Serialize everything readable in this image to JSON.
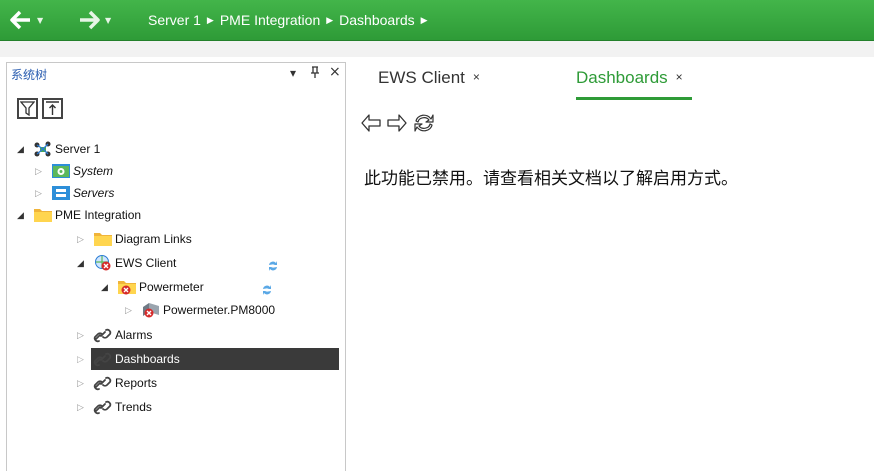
{
  "breadcrumb": {
    "items": [
      "Server 1",
      "PME Integration",
      "Dashboards"
    ]
  },
  "panel": {
    "title": "系统树",
    "ctl_pin_dropdown": "▾",
    "ctl_pin": "ᵻ",
    "ctl_close": "×"
  },
  "tree": [
    {
      "label": "Server 1",
      "icon": "server-network-icon",
      "italic": false
    },
    {
      "label": "System",
      "icon": "system-gear-folder-icon",
      "italic": true
    },
    {
      "label": "Servers",
      "icon": "servers-folder-icon",
      "italic": true
    },
    {
      "label": "PME Integration",
      "icon": "folder-icon",
      "italic": false
    },
    {
      "label": "Diagram Links",
      "icon": "folder-icon",
      "italic": false
    },
    {
      "label": "EWS Client",
      "icon": "ews-client-error-icon",
      "italic": false
    },
    {
      "label": "Powermeter",
      "icon": "folder-error-icon",
      "italic": false
    },
    {
      "label": "Powermeter.PM8000",
      "icon": "device-error-icon",
      "italic": false
    },
    {
      "label": "Alarms",
      "icon": "link-icon",
      "italic": false
    },
    {
      "label": "Dashboards",
      "icon": "link-icon",
      "italic": false
    },
    {
      "label": "Reports",
      "icon": "link-icon",
      "italic": false
    },
    {
      "label": "Trends",
      "icon": "link-icon",
      "italic": false
    }
  ],
  "tabs": [
    {
      "label": "EWS Client",
      "close": "×",
      "active": false
    },
    {
      "label": "Dashboards",
      "close": "×",
      "active": true
    }
  ],
  "content": {
    "message": "此功能已禁用。请查看相关文档以了解启用方式。"
  },
  "colors": {
    "accent_green": "#2e9b37",
    "selected_row": "#3a3a3a",
    "error_red": "#d62b2b"
  }
}
